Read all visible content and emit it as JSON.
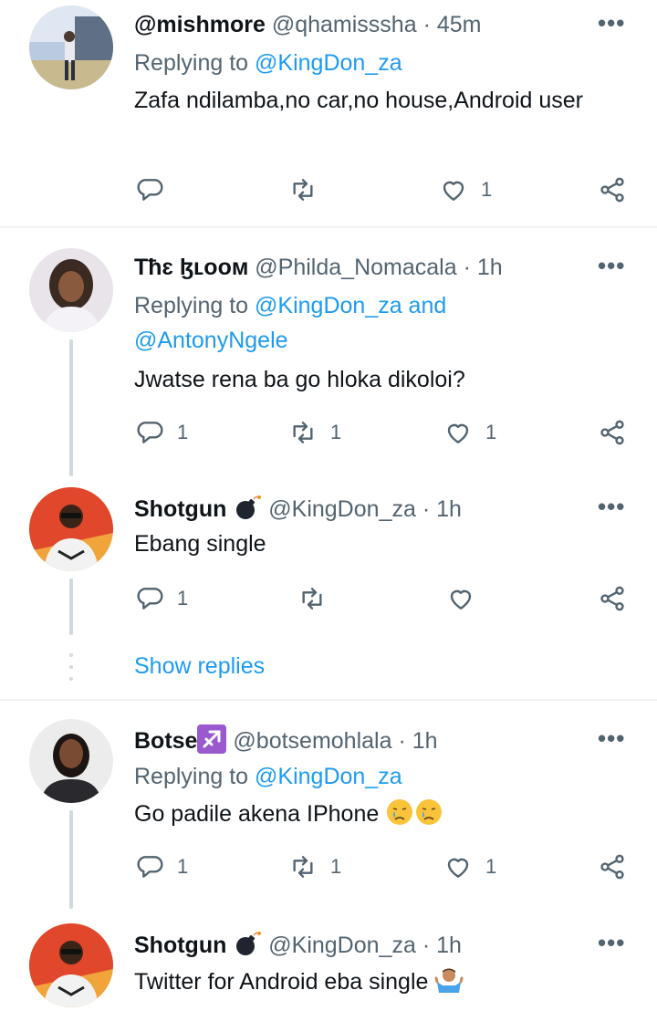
{
  "tweets": [
    {
      "display_name": "@mishmore",
      "handle": "@qhamisssha",
      "time": "· 45m",
      "replying_prefix": "Replying to",
      "replying_to": "@KingDon_za",
      "replying_line2": "",
      "body": "Zafa ndilamba,no car,no house,Android user",
      "replies": "",
      "retweets": "",
      "likes": "1",
      "more": "•••"
    },
    {
      "display_name": "Tħɛ ɮʟooм",
      "handle": "@Philda_Nomacala",
      "time": "· 1h",
      "replying_prefix": "Replying to",
      "replying_to": "@KingDon_za and",
      "replying_line2": "@AntonyNgele",
      "body": "Jwatse rena ba go hloka dikoloi?",
      "replies": "1",
      "retweets": "1",
      "likes": "1",
      "more": "•••"
    },
    {
      "display_name": "Shotgun",
      "handle": "@KingDon_za",
      "time": "· 1h",
      "body": "Ebang single",
      "replies": "1",
      "retweets": "",
      "likes": "",
      "more": "•••"
    },
    {
      "display_name": "Botse",
      "handle": "@botsemohlala",
      "time": "· 1h",
      "replying_prefix": "Replying to",
      "replying_to": "@KingDon_za",
      "body": "Go padile akena IPhone",
      "replies": "1",
      "retweets": "1",
      "likes": "1",
      "more": "•••"
    },
    {
      "display_name": "Shotgun",
      "handle": "@KingDon_za",
      "time": "· 1h",
      "body": "Twitter for Android eba single",
      "more": "•••"
    }
  ],
  "show_replies": "Show replies",
  "colors": {
    "link": "#1d9bf0",
    "muted": "#536471",
    "text": "#0f1419",
    "line": "#cfd9de"
  }
}
